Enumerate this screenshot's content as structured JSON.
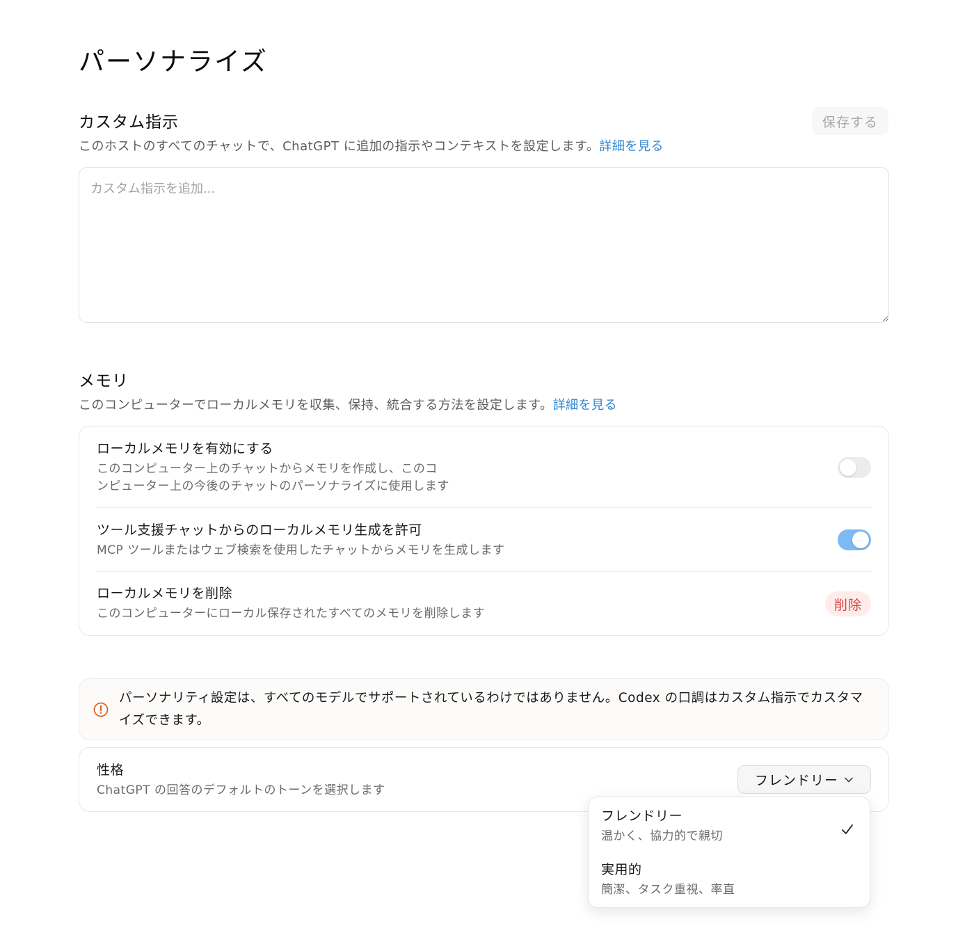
{
  "page": {
    "title": "パーソナライズ"
  },
  "custom_instructions": {
    "title": "カスタム指示",
    "description": "このホストのすべてのチャットで、ChatGPT に追加の指示やコンテキストを設定します。",
    "learn_more": "詳細を見る",
    "save_label": "保存する",
    "placeholder": "カスタム指示を追加...",
    "value": ""
  },
  "memory": {
    "title": "メモリ",
    "description": "このコンピューターでローカルメモリを収集、保持、統合する方法を設定します。",
    "learn_more": "詳細を見る",
    "rows": [
      {
        "title": "ローカルメモリを有効にする",
        "desc_line1": "このコンピューター上のチャットからメモリを作成し、このコ",
        "desc_line2": "ンピューター上の今後のチャットのパーソナライズに使用します",
        "toggle": "off"
      },
      {
        "title": "ツール支援チャットからのローカルメモリ生成を許可",
        "desc_line1": "MCP ツールまたはウェブ検索を使用したチャットからメモリを生成します",
        "toggle": "on"
      },
      {
        "title": "ローカルメモリを削除",
        "desc_line1": "このコンピューターにローカル保存されたすべてのメモリを削除します",
        "action_label": "削除"
      }
    ]
  },
  "warning": {
    "text": "パーソナリティ設定は、すべてのモデルでサポートされているわけではありません。Codex の口調はカスタム指示でカスタマイズできます。",
    "icon": "alert-circle-icon"
  },
  "personality": {
    "title": "性格",
    "description": "ChatGPT の回答のデフォルトのトーンを選択します",
    "selected": "フレンドリー",
    "options": [
      {
        "label": "フレンドリー",
        "desc": "温かく、協力的で親切",
        "checked": true
      },
      {
        "label": "実用的",
        "desc": "簡潔、タスク重視、率直",
        "checked": false
      }
    ]
  },
  "colors": {
    "link": "#2f86d1",
    "toggle_on": "#7db9f2",
    "danger": "#d6453d",
    "warning_icon": "#e0621f"
  }
}
